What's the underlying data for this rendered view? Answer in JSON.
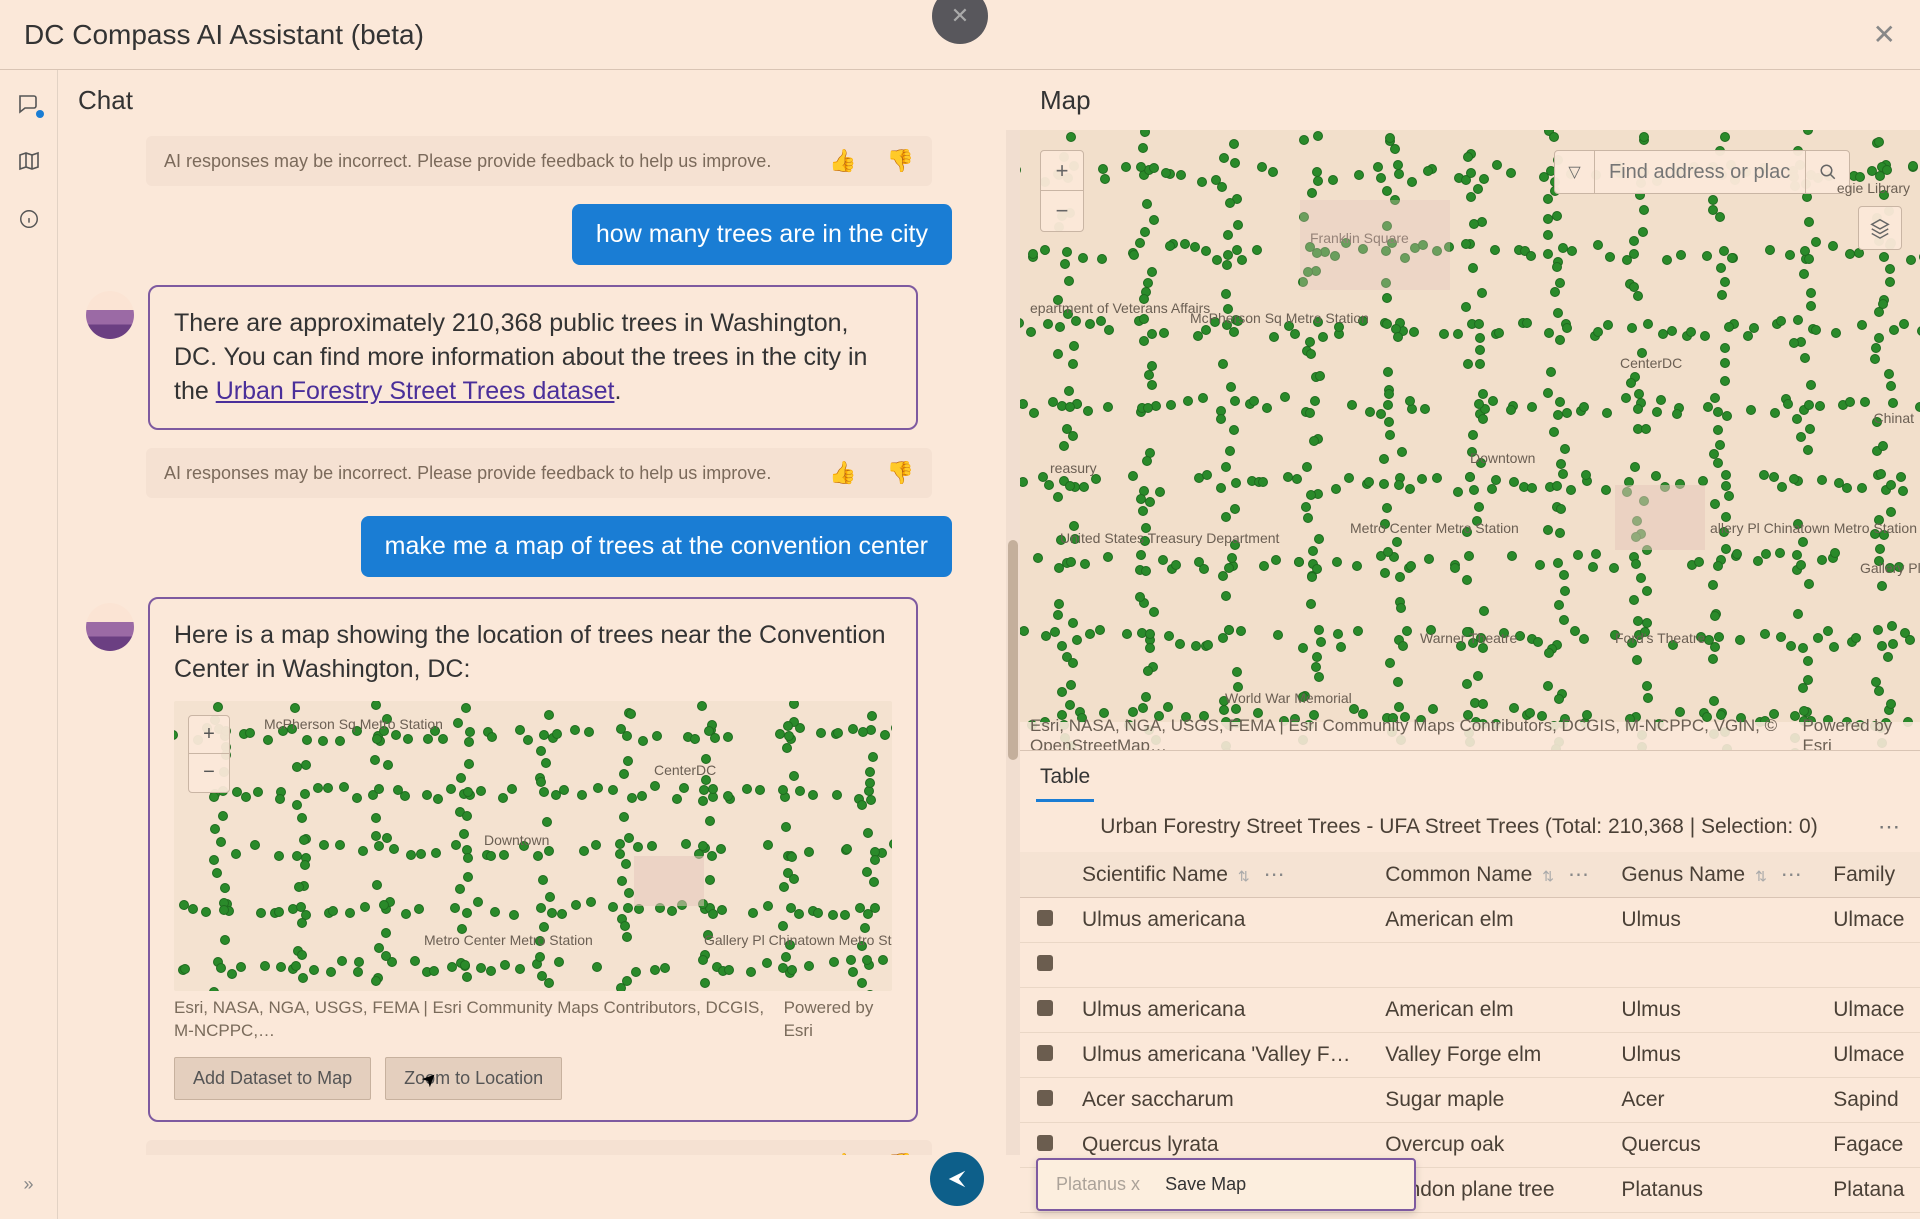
{
  "title": "DC Compass AI Assistant (beta)",
  "chat": {
    "header": "Chat",
    "disclaimer": "AI responses may be incorrect. Please provide feedback to help us improve.",
    "msg1_user": "how many trees are in the city",
    "msg1_ai_pre": "There are approximately 210,368 public trees in Washington, DC. You can find more information about the trees in the city in the ",
    "msg1_ai_link": "Urban Forestry Street Trees dataset",
    "msg1_ai_post": ".",
    "msg2_user": "make me a map of trees at the convention center",
    "msg2_ai_intro": "Here is a map showing the location of trees near the Convention Center in Washington, DC:",
    "mini_attrib_left": "Esri, NASA, NGA, USGS, FEMA | Esri Community Maps Contributors, DCGIS, M-NCPPC,…",
    "mini_attrib_right": "Powered by Esri",
    "btn_add": "Add Dataset to Map",
    "btn_zoom": "Zoom to Location",
    "mini_labels": {
      "mcph": "McPherson Sq\nMetro Station",
      "centerdc": "CenterDC",
      "downtown": "Downtown",
      "metrocenter": "Metro Center\nMetro Station",
      "chinatown": "Gallery Pl\nChinatown\nMetro Station"
    }
  },
  "map": {
    "header": "Map",
    "search_placeholder": "Find address or place",
    "attrib_left": "Esri, NASA, NGA, USGS, FEMA | Esri Community Maps Contributors, DCGIS, M-NCPPC, VGIN, © OpenStreetMap…",
    "attrib_right": "Powered by Esri",
    "labels": {
      "franklin": "Franklin Square",
      "mcph": "McPherson Sq\nMetro Station",
      "va": "epartment\nof Veterans\nAffairs",
      "centerdc": "CenterDC",
      "treasury": "reasury",
      "downtown": "Downtown",
      "ustreas": "United States\nTreasury\nDepartment",
      "metrocenter": "Metro Center\nMetro Station",
      "gallery": "allery Pl\nChinatown\nMetro Station",
      "galleryicon": "Gallery Pl |\nChinatown\nMetro Station",
      "warner": "Warner\nTheatre",
      "ford": "Ford's Theatre",
      "wwmem": "World War\nMemorial",
      "chinat": "Chinat",
      "library": "egie\nLibrary"
    }
  },
  "table": {
    "tab": "Table",
    "title": "Urban Forestry Street Trees - UFA Street Trees (Total: 210,368 | Selection: 0)",
    "columns": [
      "Scientific Name",
      "Common Name",
      "Genus Name",
      "Family"
    ],
    "rows": [
      {
        "sci": "Ulmus americana",
        "common": "American elm",
        "genus": "Ulmus",
        "family": "Ulmace"
      },
      {
        "sci": "",
        "common": "",
        "genus": "",
        "family": ""
      },
      {
        "sci": "Ulmus americana",
        "common": "American elm",
        "genus": "Ulmus",
        "family": "Ulmace"
      },
      {
        "sci": "Ulmus americana 'Valley F…",
        "common": "Valley Forge elm",
        "genus": "Ulmus",
        "family": "Ulmace"
      },
      {
        "sci": "Acer saccharum",
        "common": "Sugar maple",
        "genus": "Acer",
        "family": "Sapind"
      },
      {
        "sci": "Quercus lyrata",
        "common": "Overcup oak",
        "genus": "Quercus",
        "family": "Fagace"
      },
      {
        "sci": "Platanus x",
        "common": "London plane tree",
        "genus": "Platanus",
        "family": "Platana"
      }
    ],
    "save_popup": "Save Map"
  }
}
